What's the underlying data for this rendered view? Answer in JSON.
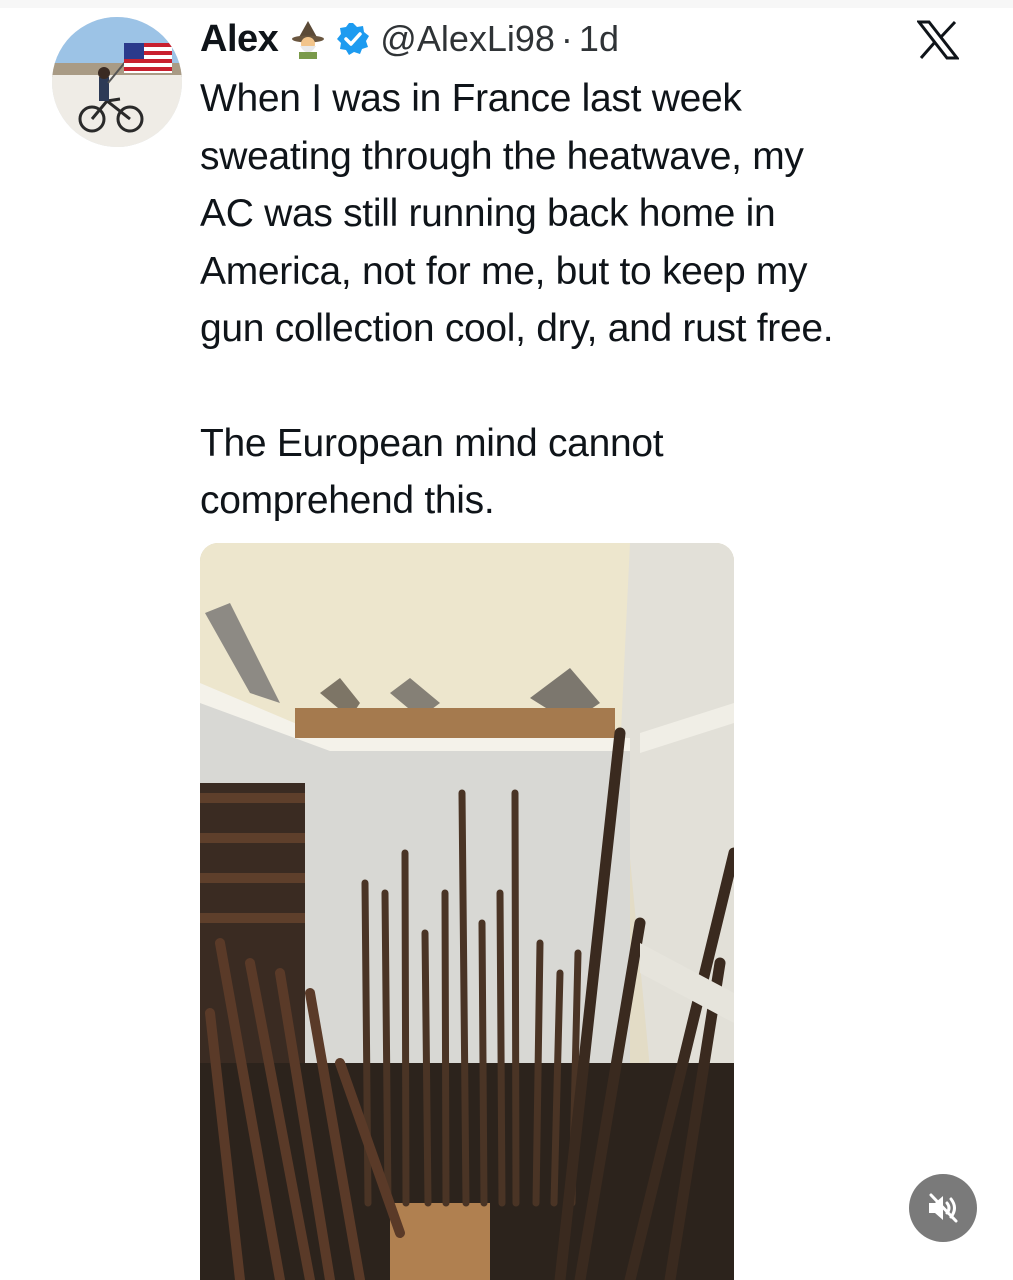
{
  "tweet": {
    "author_name": "Alex",
    "handle": "@AlexLi98",
    "separator": "·",
    "timestamp": "1d",
    "paragraphs": [
      [
        "When I was in France last week",
        "sweating through the heatwave, my",
        "AC was still running back home in",
        "America, not for me, but to keep my",
        "gun collection cool, dry, and rust free."
      ],
      [
        "The European mind cannot",
        "comprehend this."
      ]
    ]
  },
  "icons": {
    "name_emoji": "mage-emoji-icon",
    "verified": "verified-badge-icon",
    "brand": "x-logo-icon",
    "mute": "muted-speaker-icon"
  },
  "colors": {
    "verified": "#1d9bf0",
    "text": "#0f1419",
    "secondary_text": "#2f3336",
    "mute_button": "#7a7a7a"
  }
}
